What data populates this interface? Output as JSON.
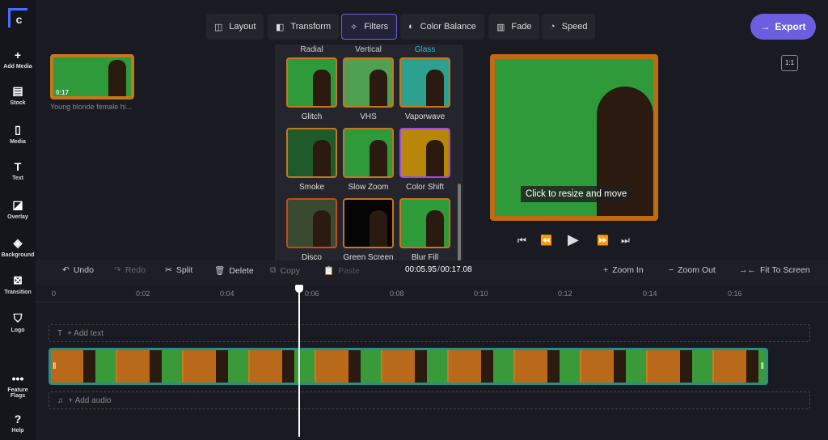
{
  "sidebar": {
    "items": [
      {
        "label": "Add Media",
        "icon": "plus-icon"
      },
      {
        "label": "Stock",
        "icon": "stock-icon"
      },
      {
        "label": "Media",
        "icon": "file-icon"
      },
      {
        "label": "Text",
        "icon": "text-icon"
      },
      {
        "label": "Overlay",
        "icon": "overlay-icon"
      },
      {
        "label": "Background",
        "icon": "layers-icon"
      },
      {
        "label": "Transition",
        "icon": "transition-icon"
      },
      {
        "label": "Logo",
        "icon": "shield-icon"
      },
      {
        "label": "Feature Flags",
        "icon": "dots-icon"
      },
      {
        "label": "Help",
        "icon": "help-icon"
      }
    ]
  },
  "toolbar": {
    "layout": "Layout",
    "transform": "Transform",
    "filters": "Filters",
    "color_balance": "Color Balance",
    "fade": "Fade",
    "speed": "Speed",
    "export": "Export"
  },
  "media": {
    "duration": "0:17",
    "title": "Young blonde female hi..."
  },
  "filters": {
    "partial": [
      "Radial",
      "Vertical",
      "Glass"
    ],
    "items": [
      "Glitch",
      "VHS",
      "Vaporwave",
      "Smoke",
      "Slow Zoom",
      "Color Shift",
      "Disco",
      "Green Screen",
      "Blur Fill"
    ]
  },
  "preview": {
    "tooltip": "Click to resize and move",
    "aspect": "1:1"
  },
  "timeline": {
    "undo": "Undo",
    "redo": "Redo",
    "split": "Split",
    "delete": "Delete",
    "copy": "Copy",
    "paste": "Paste",
    "current": "00:05.95",
    "total": "00:17.08",
    "zoom_in": "Zoom In",
    "zoom_out": "Zoom Out",
    "fit": "Fit To Screen",
    "ticks": [
      "0",
      "0:02",
      "0:04",
      "0:06",
      "0:08",
      "0:10",
      "0:12",
      "0:14",
      "0:16"
    ],
    "add_text": "+ Add text",
    "add_audio": "+ Add audio"
  },
  "colors": {
    "accent": "#6b5fe0",
    "clip_border": "#2a8f80"
  }
}
